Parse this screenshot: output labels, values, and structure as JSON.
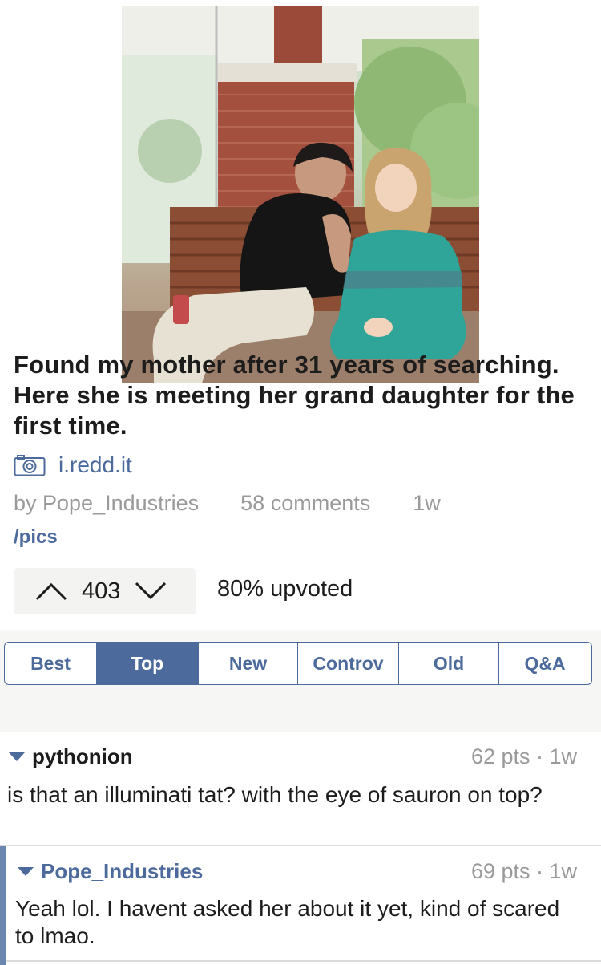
{
  "post": {
    "title": "Found my mother after 31 years of searching. Here she is meeting her grand daughter for the first time.",
    "domain": "i.redd.it",
    "author": "by Pope_Industries",
    "comments": "58 comments",
    "age": "1w",
    "subreddit": "/pics",
    "score": "403",
    "upvoted": "80% upvoted",
    "icons": {
      "media": "camera-icon",
      "upvote": "up-arrow-icon",
      "downvote": "down-arrow-icon"
    }
  },
  "sort": {
    "tabs": [
      "Best",
      "Top",
      "New",
      "Controv",
      "Old",
      "Q&A"
    ],
    "active": "Top"
  },
  "comments": [
    {
      "author": "pythonion",
      "points": "62 pts · 1w",
      "body": "is that an illuminati tat?  with the eye of sauron on top?",
      "author_color": "#1c1c1c"
    },
    {
      "author": "Pope_Industries",
      "points": "69 pts · 1w",
      "body": "Yeah lol. I havent asked her about it yet, kind of scared to lmao.",
      "author_color": "#4c6a9c"
    }
  ],
  "colors": {
    "accent": "#4c6a9c",
    "muted": "#9a9a9a"
  }
}
